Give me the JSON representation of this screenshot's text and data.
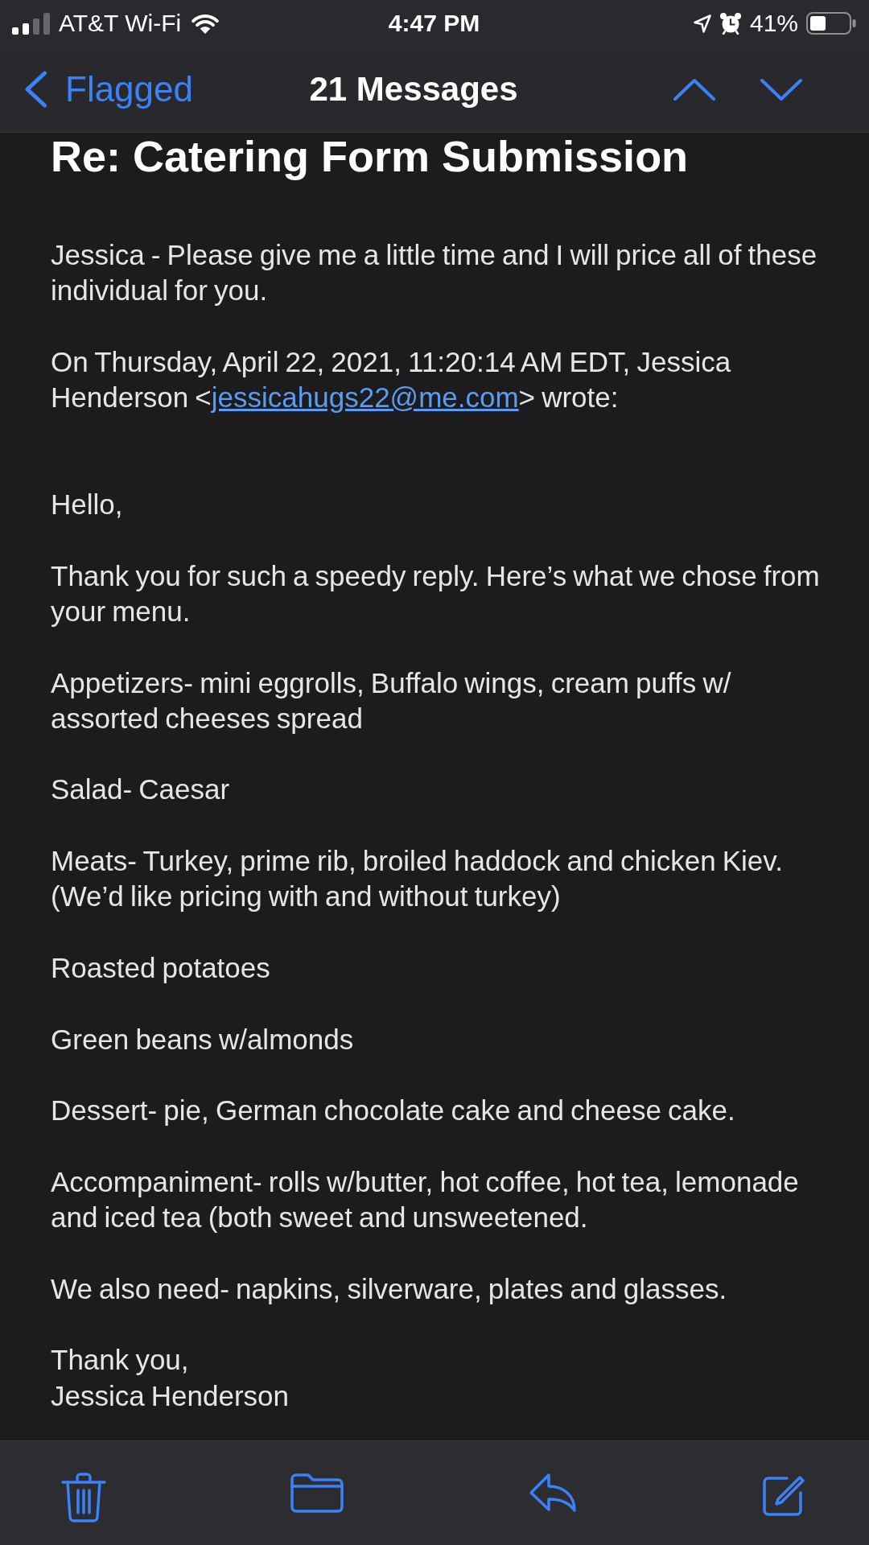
{
  "status_bar": {
    "carrier": "AT&T Wi-Fi",
    "time": "4:47 PM",
    "battery": "41%"
  },
  "nav_bar": {
    "back": "Flagged",
    "title": "21 Messages"
  },
  "message": {
    "subject": "Re: Catering Form Submission",
    "reply": "Jessica - Please give me a little time and I will price all of these individual for you.",
    "quote_header": {
      "text_before": "On Thursday, April 22, 2021, 11:20:14 AM EDT, Jessica Henderson <",
      "email": "jessicahugs22@me.com",
      "text_after": "> wrote:"
    },
    "quoted_paragraphs": [
      "Hello,",
      "Thank you for such a speedy reply. Here’s what we chose from your menu.",
      "Appetizers- mini eggrolls, Buffalo wings, cream puffs w/ assorted cheeses spread",
      "Salad- Caesar",
      "Meats- Turkey, prime rib, broiled haddock and chicken Kiev. (We’d like pricing with and without turkey)",
      "Roasted potatoes",
      "Green beans w/almonds",
      "Dessert- pie, German chocolate cake and cheese cake.",
      "Accompaniment- rolls w/butter, hot coffee, hot tea, lemonade and iced tea (both sweet and unsweetened.",
      "We also need- napkins, silverware, plates and glasses."
    ],
    "closing": "Thank you,",
    "signature": "Jessica Henderson"
  },
  "toolbar": {
    "actions": [
      {
        "kind": "trash"
      },
      {
        "kind": "folder"
      },
      {
        "kind": "reply"
      },
      {
        "kind": "compose"
      }
    ]
  }
}
